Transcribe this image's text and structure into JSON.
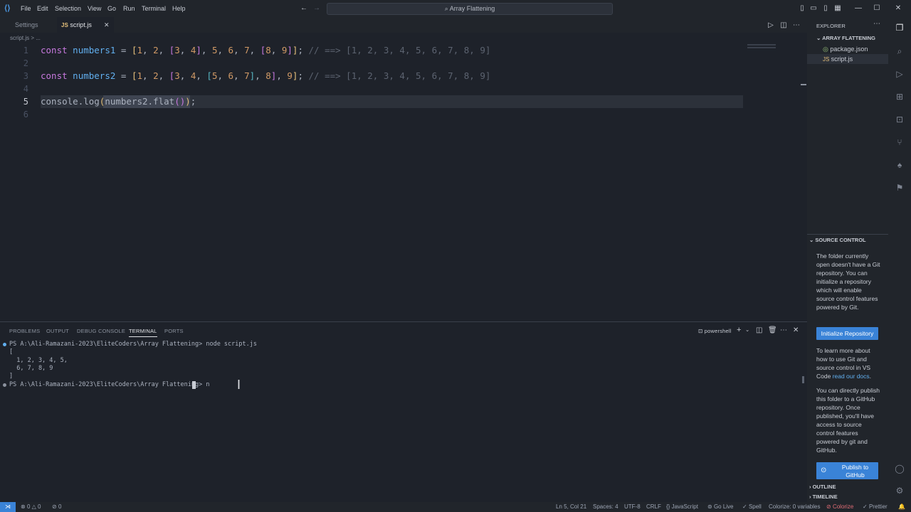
{
  "titlebar": {
    "menus": [
      "File",
      "Edit",
      "Selection",
      "View",
      "Go",
      "Run",
      "Terminal",
      "Help"
    ],
    "command_center": "Array Flattening"
  },
  "tabs": [
    {
      "label": "Settings"
    },
    {
      "label": "script.js"
    }
  ],
  "breadcrumb": "script.js > ...",
  "editor": {
    "line_numbers": [
      "1",
      "2",
      "3",
      "4",
      "5",
      "6"
    ],
    "line1": {
      "kw": "const",
      "name": "numbers1",
      "comment": "// ==> [1, 2, 3, 4, 5, 6, 7, 8, 9]"
    },
    "line3": {
      "kw": "const",
      "name": "numbers2",
      "comment": "// ==> [1, 2, 3, 4, 5, 6, 7, 8, 9]"
    },
    "line5": {
      "obj": "console",
      "method": "log",
      "arg": "numbers2",
      "call": "flat"
    }
  },
  "panel": {
    "tabs": [
      "PROBLEMS",
      "OUTPUT",
      "DEBUG CONSOLE",
      "TERMINAL",
      "PORTS"
    ],
    "shell": "powershell",
    "terminal_lines": [
      "PS A:\\Ali-Ramazani-2023\\EliteCoders\\Array Flattening> node script.js",
      "[",
      "  1, 2, 3, 4, 5,",
      "  6, 7, 8, 9",
      "]",
      "PS A:\\Ali-Ramazani-2023\\EliteCoders\\Array Flattening> n"
    ]
  },
  "sidebar": {
    "explorer_title": "EXPLORER",
    "folder": "ARRAY FLATTENING",
    "files": [
      "package.json",
      "script.js"
    ],
    "source_control_title": "SOURCE CONTROL",
    "sc_text1": "The folder currently open doesn't have a Git repository. You can initialize a repository which will enable source control features powered by Git.",
    "init_button": "Initialize Repository",
    "sc_text2a": "To learn more about how to use Git and source control in VS Code ",
    "sc_link": "read our docs",
    "sc_text3": "You can directly publish this folder to a GitHub repository. Once published, you'll have access to source control features powered by git and GitHub.",
    "publish_button": "Publish to GitHub",
    "outline": "OUTLINE",
    "timeline": "TIMELINE"
  },
  "status": {
    "errors": "0",
    "warnings": "0",
    "ports": "0",
    "position": "Ln 5, Col 21",
    "spaces": "Spaces: 4",
    "encoding": "UTF-8",
    "eol": "CRLF",
    "language": "{} JavaScript",
    "golive": "Go Live",
    "spell": "Spell",
    "colorize_vars": "Colorize: 0 variables",
    "colorize": "Colorize",
    "prettier": "Prettier"
  }
}
